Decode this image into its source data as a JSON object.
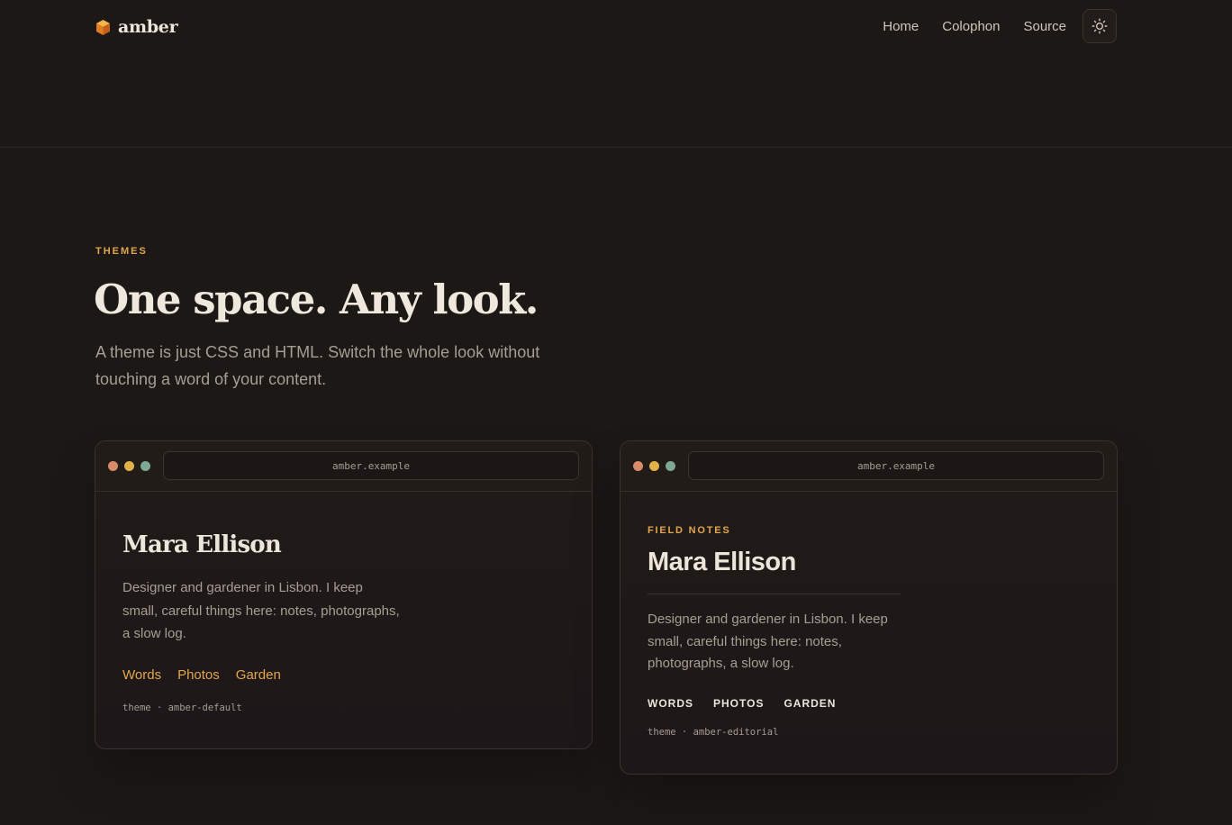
{
  "header": {
    "brand": "amber",
    "nav": [
      "Home",
      "Colophon",
      "Source"
    ]
  },
  "hero": {
    "eyebrow": "THEMES",
    "title": "One space. Any look.",
    "subtitle": "A theme is just CSS and HTML. Switch the whole look without touching a word of your content."
  },
  "cards": [
    {
      "url": "amber.example",
      "name": "Mara Ellison",
      "bio": "Designer and gardener in Lisbon. I keep small, careful things here: notes, photographs, a slow log.",
      "links": [
        "Words",
        "Photos",
        "Garden"
      ],
      "meta": "theme · amber-default"
    },
    {
      "url": "amber.example",
      "eyebrow": "FIELD NOTES",
      "name": "Mara Ellison",
      "bio": "Designer and gardener in Lisbon. I keep small, careful things here: notes, photographs, a slow log.",
      "links": [
        "WORDS",
        "PHOTOS",
        "GARDEN"
      ],
      "meta": "theme · amber-editorial"
    }
  ],
  "icons": {
    "brand": "amber-cube-icon",
    "theme_toggle": "sun-icon"
  },
  "colors": {
    "background": "#1c1816",
    "accent": "#e2a64e",
    "text": "#e9e2d8",
    "muted": "#a79e93",
    "dot_red": "#d98b6a",
    "dot_yellow": "#e2b24a",
    "dot_green": "#7fa893"
  }
}
